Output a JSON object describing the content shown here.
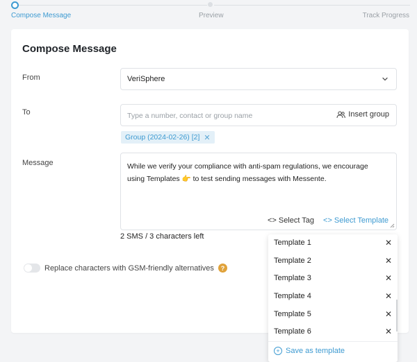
{
  "stepper": {
    "steps": [
      "Compose Message",
      "Preview",
      "Track Progress"
    ]
  },
  "card": {
    "title": "Compose Message"
  },
  "from": {
    "label": "From",
    "value": "VeriSphere"
  },
  "to": {
    "label": "To",
    "placeholder": "Type a number, contact or group name",
    "insert_group_label": "Insert group",
    "chip_label": "Group (2024-02-26) [2]",
    "chip_close": "✕"
  },
  "message": {
    "label": "Message",
    "text": "While we verify your compliance with anti-spam regulations, we encourage using Templates 👉 to test sending messages with Messente.",
    "select_tag_label": "<> Select Tag",
    "select_template_label": "<> Select Template",
    "sms_count": "2 SMS / 3 characters left"
  },
  "gsm": {
    "toggle_label": "Replace characters with GSM-friendly alternatives",
    "help": "?"
  },
  "templates": {
    "items": [
      "Template 1",
      "Template 2",
      "Template 3",
      "Template 4",
      "Template 5",
      "Template 6"
    ],
    "close": "✕",
    "save_label": "Save as template",
    "save_icon": "+"
  },
  "colors": {
    "accent": "#3d9ad1",
    "chip_bg": "#e3f0f8",
    "help": "#e0a23a"
  }
}
